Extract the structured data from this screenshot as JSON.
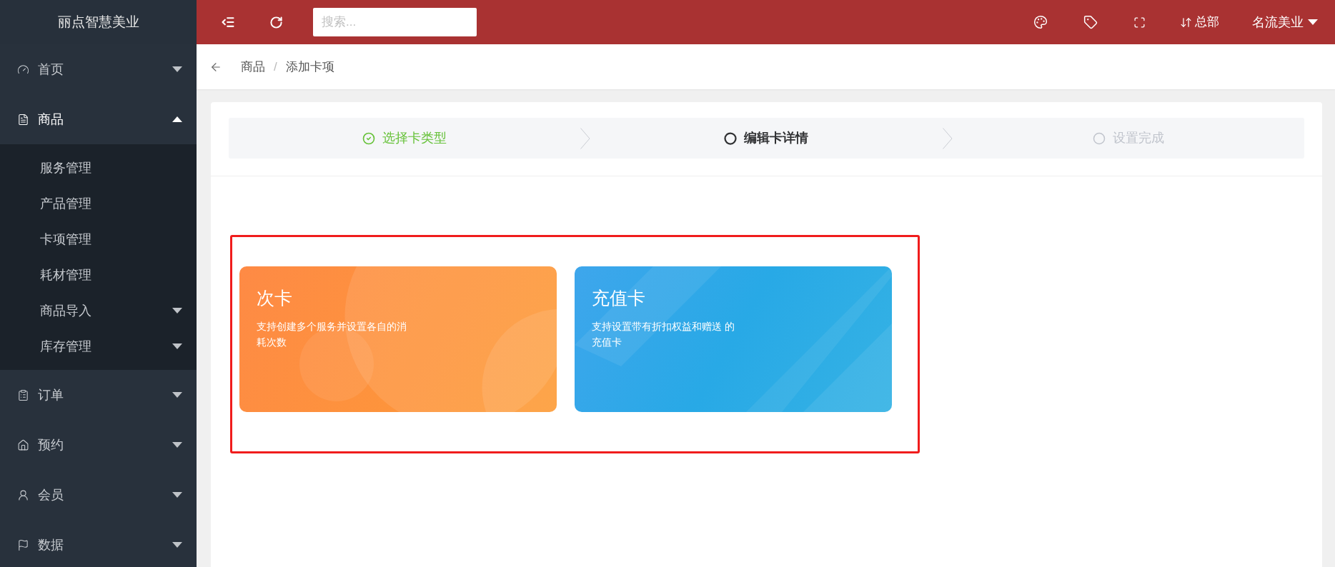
{
  "brand": "丽点智慧美业",
  "search": {
    "placeholder": "搜索..."
  },
  "header": {
    "store": "总部",
    "account": "名流美业"
  },
  "breadcrumb": {
    "separator": "/",
    "items": [
      "商品",
      "添加卡项"
    ]
  },
  "sidebar": {
    "items": [
      {
        "kind": "gauge",
        "label": "首页",
        "expanded": false
      },
      {
        "kind": "document",
        "label": "商品",
        "expanded": true,
        "children": [
          {
            "label": "服务管理"
          },
          {
            "label": "产品管理"
          },
          {
            "label": "卡项管理"
          },
          {
            "label": "耗材管理"
          },
          {
            "label": "商品导入",
            "expanded": false
          },
          {
            "label": "库存管理",
            "expanded": false
          }
        ]
      },
      {
        "kind": "clipboard",
        "label": "订单",
        "expanded": false
      },
      {
        "kind": "home",
        "label": "预约",
        "expanded": false
      },
      {
        "kind": "user",
        "label": "会员",
        "expanded": false
      },
      {
        "kind": "flag",
        "label": "数据",
        "expanded": false
      }
    ]
  },
  "steps": [
    {
      "kind": "done",
      "label": "选择卡类型"
    },
    {
      "kind": "active",
      "label": "编辑卡详情"
    },
    {
      "kind": "pending",
      "label": "设置完成"
    }
  ],
  "cards": [
    {
      "kind": "circles",
      "title": "次卡",
      "description": "支持创建多个服务并设置各自的消耗次数"
    },
    {
      "kind": "stripes",
      "title": "充值卡",
      "description": "支持设置带有折扣权益和赠送 的充值卡"
    }
  ]
}
